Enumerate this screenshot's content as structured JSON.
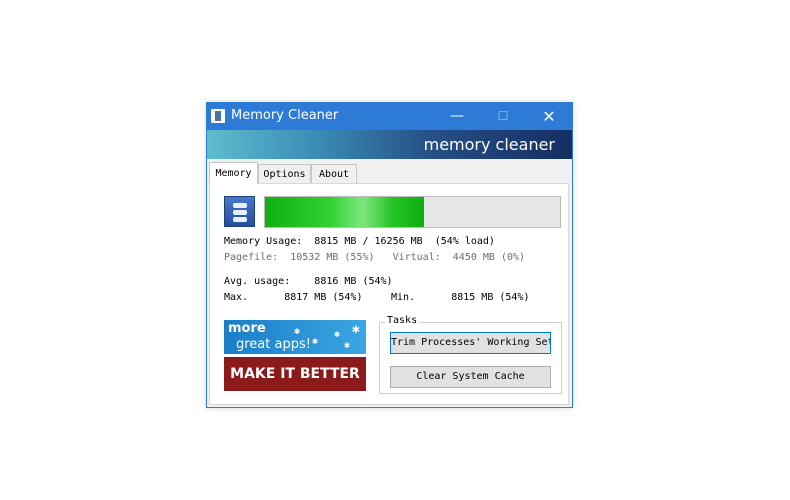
{
  "window": {
    "title": "Memory Cleaner",
    "minimize": "—",
    "maximize": "☐",
    "close": "✕"
  },
  "banner": {
    "text": "memory cleaner"
  },
  "tabs": [
    {
      "label": "Memory",
      "active": true
    },
    {
      "label": "Options",
      "active": false
    },
    {
      "label": "About",
      "active": false
    }
  ],
  "memory": {
    "load_fraction": 0.54,
    "usage": "Memory Usage:  8815 MB / 16256 MB  (54% load)",
    "pagefile": "Pagefile:  10532 MB (55%)   Virtual:  4450 MB (0%)",
    "avg": "Avg. usage:    8816 MB (54%)",
    "max": "Max.      8817 MB (54%)",
    "min": "Min.      8815 MB (54%)"
  },
  "ads": {
    "more_line1": "more",
    "more_line2": "great apps!",
    "better": "MAKE IT BETTER"
  },
  "tasks": {
    "legend": "Tasks",
    "trim_label": "Trim Processes' Working Set",
    "clear_label": "Clear System Cache"
  },
  "colors": {
    "titlebar": "#2d7bd6",
    "progress_green": "#2fd02f",
    "ad_red": "#8b1a1a"
  }
}
